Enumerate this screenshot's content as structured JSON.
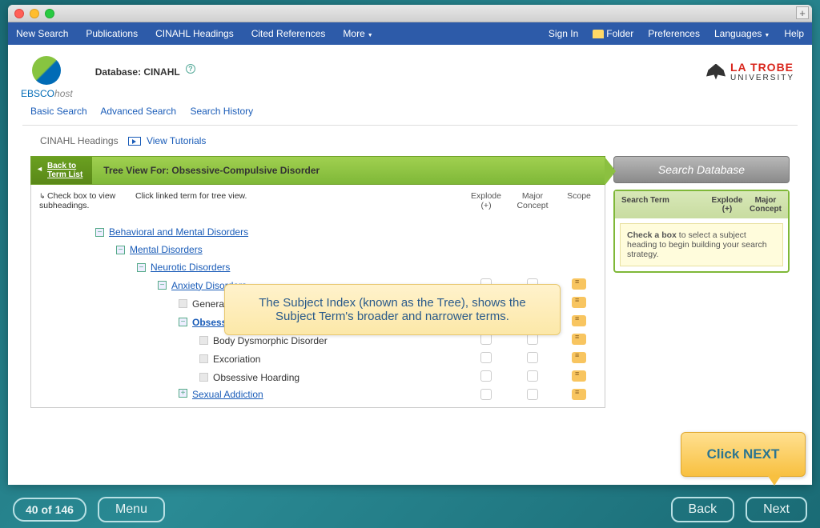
{
  "titlebar": {
    "plus": "+"
  },
  "topnav": {
    "left": [
      "New Search",
      "Publications",
      "CINAHL Headings",
      "Cited References",
      "More"
    ],
    "right": {
      "signin": "Sign In",
      "folder": "Folder",
      "prefs": "Preferences",
      "lang": "Languages",
      "help": "Help"
    }
  },
  "header": {
    "ebsco": {
      "brand": "EBSCO",
      "suffix": "host"
    },
    "database_label": "Database: CINAHL",
    "latrobe": {
      "line1": "LA TROBE",
      "line2": "UNIVERSITY"
    }
  },
  "search_links": [
    "Basic Search",
    "Advanced Search",
    "Search History"
  ],
  "subbar": {
    "headings": "CINAHL Headings",
    "tutorials": "View Tutorials"
  },
  "greenbar": {
    "back1": "Back to",
    "back2": "Term List",
    "label": "Tree View For: Obsessive-Compulsive Disorder"
  },
  "instructions": {
    "left": "Check box to view subheadings.",
    "mid": "Click linked term for tree view.",
    "cols": [
      "Explode (+)",
      "Major Concept",
      "Scope"
    ]
  },
  "tree": [
    {
      "indent": 0,
      "expand": "−",
      "label": "Behavioral and Mental Disorders",
      "link": true,
      "cols": false
    },
    {
      "indent": 1,
      "expand": "−",
      "label": "Mental Disorders",
      "link": true,
      "cols": false
    },
    {
      "indent": 2,
      "expand": "−",
      "label": "Neurotic Disorders",
      "link": true,
      "cols": false
    },
    {
      "indent": 3,
      "expand": "−",
      "label": "Anxiety Disorders",
      "link": true,
      "cols": true
    },
    {
      "indent": 4,
      "expand": "",
      "label": "Generalized Anxiety Disorder",
      "link": false,
      "cols": true
    },
    {
      "indent": 4,
      "expand": "−",
      "label": "Obsessive-Compulsive Disorder",
      "link": true,
      "bold": true,
      "cols": true
    },
    {
      "indent": 5,
      "expand": "",
      "label": "Body Dysmorphic Disorder",
      "link": false,
      "cols": true
    },
    {
      "indent": 5,
      "expand": "",
      "label": "Excoriation",
      "link": false,
      "cols": true
    },
    {
      "indent": 5,
      "expand": "",
      "label": "Obsessive Hoarding",
      "link": false,
      "cols": true
    },
    {
      "indent": 4,
      "expand": "+",
      "label": "Sexual Addiction",
      "link": true,
      "cols": true,
      "cut": true
    }
  ],
  "rightpane": {
    "search_db": "Search Database",
    "headers": {
      "term": "Search Term",
      "explode": "Explode (+)",
      "major": "Major Concept"
    },
    "tip_bold": "Check a box",
    "tip_rest": " to select a subject heading to begin building your search strategy."
  },
  "callout": "The Subject Index (known as the Tree), shows the Subject Term's broader and narrower terms.",
  "click_next": "Click NEXT",
  "bottombar": {
    "page": "40 of 146",
    "menu": "Menu",
    "back": "Back",
    "next": "Next"
  }
}
